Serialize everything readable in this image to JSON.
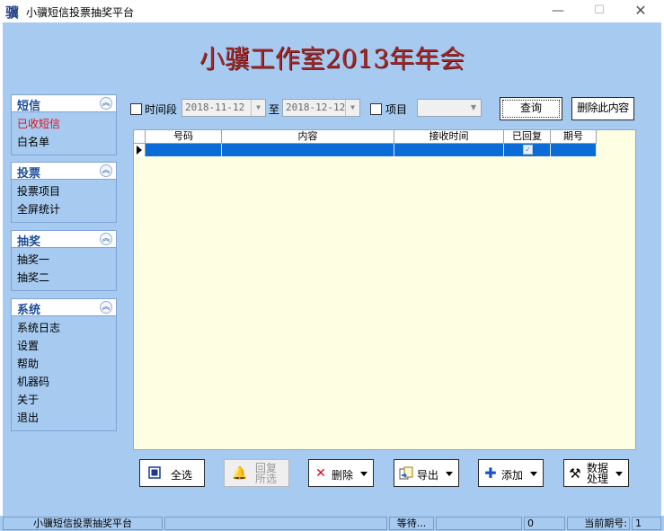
{
  "window": {
    "icon_glyph": "骥",
    "title": "小骥短信投票抽奖平台",
    "min_glyph": "—",
    "max_glyph": "☐",
    "close_glyph": "✕"
  },
  "banner": {
    "text": "小骥工作室2013年年会"
  },
  "sidebar": {
    "groups": [
      {
        "title": "短信",
        "items": [
          "已收短信",
          "白名单"
        ]
      },
      {
        "title": "投票",
        "items": [
          "投票项目",
          "全屏统计"
        ]
      },
      {
        "title": "抽奖",
        "items": [
          "抽奖一",
          "抽奖二"
        ]
      },
      {
        "title": "系统",
        "items": [
          "系统日志",
          "设置",
          "帮助",
          "机器码",
          "关于",
          "退出"
        ]
      }
    ],
    "collapse_glyph": "︽"
  },
  "filter": {
    "timerange_label": "时间段",
    "date_from": "2018-11-12",
    "to_label": "至",
    "date_to": "2018-12-12",
    "project_label": "项目",
    "project_value": "",
    "query_label": "查询",
    "delete_content_label": "删除此内容"
  },
  "table": {
    "columns": [
      "号码",
      "内容",
      "接收时间",
      "已回复",
      "期号"
    ],
    "row_check": "✓"
  },
  "toolbar": {
    "select_all": "全选",
    "reply_selected_1": "回复",
    "reply_selected_2": "所选",
    "delete": "删除",
    "export": "导出",
    "add": "添加",
    "data_process_1": "数据",
    "data_process_2": "处理"
  },
  "status": {
    "app_name": "小骥短信投票抽奖平台",
    "state": "等待...",
    "count": "0",
    "period_label": "当前期号:",
    "period_value": "1"
  },
  "colors": {
    "client_bg": "#a6caf0",
    "banner_text": "#a02828",
    "active_item": "#e0101c",
    "selection": "#0a6cd6",
    "grid_bg": "#fefee2"
  }
}
